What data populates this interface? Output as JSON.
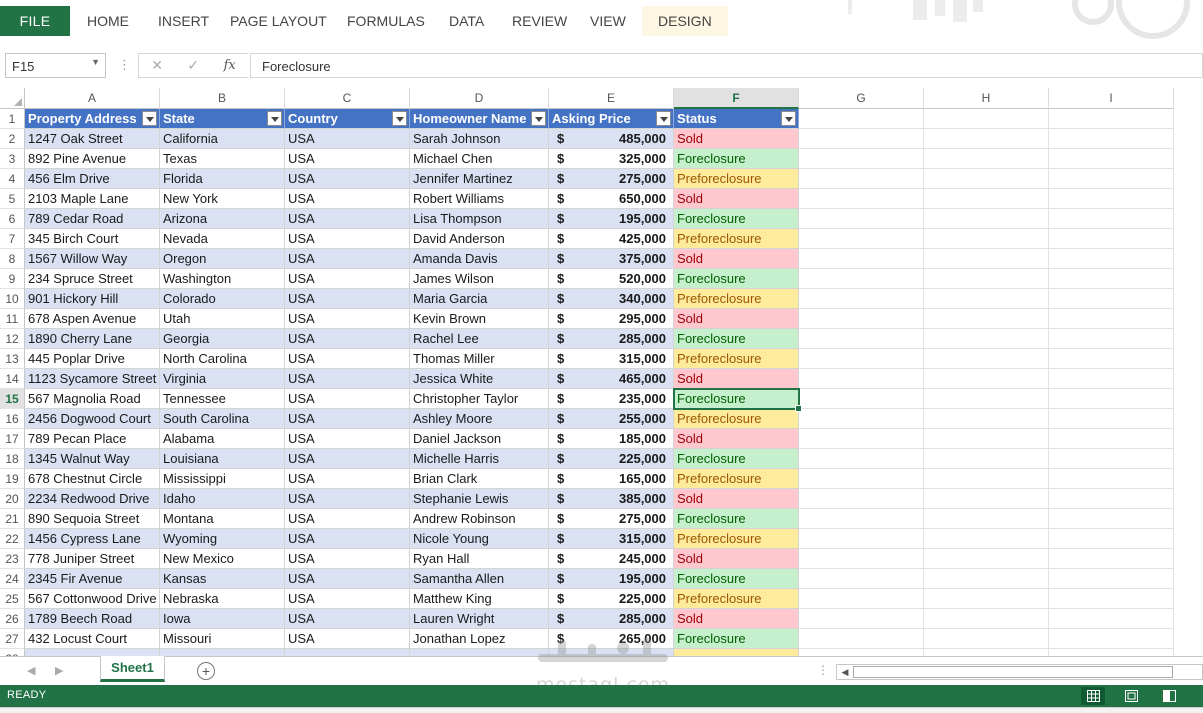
{
  "ribbon": {
    "file_label": "FILE",
    "tabs": [
      "HOME",
      "INSERT",
      "PAGE LAYOUT",
      "FORMULAS",
      "DATA",
      "REVIEW",
      "VIEW",
      "DESIGN"
    ]
  },
  "formula_bar": {
    "name_box": "F15",
    "fx_label": "fx",
    "cancel_icon": "close-icon",
    "enter_icon": "check-icon",
    "value": "Foreclosure"
  },
  "grid": {
    "columns": [
      "A",
      "B",
      "C",
      "D",
      "E",
      "F",
      "G",
      "H",
      "I"
    ],
    "selected_column": "F",
    "selected_row": 15,
    "active_cell": "F15",
    "header_row": [
      "Property Address",
      "State",
      "Country",
      "Homeowner Name",
      "Asking Price",
      "Status"
    ],
    "currency_symbol": "$",
    "rows": [
      [
        "1247 Oak Street",
        "California",
        "USA",
        "Sarah Johnson",
        "485,000",
        "Sold"
      ],
      [
        "892 Pine Avenue",
        "Texas",
        "USA",
        "Michael Chen",
        "325,000",
        "Foreclosure"
      ],
      [
        "456 Elm Drive",
        "Florida",
        "USA",
        "Jennifer Martinez",
        "275,000",
        "Preforeclosure"
      ],
      [
        "2103 Maple Lane",
        "New York",
        "USA",
        "Robert Williams",
        "650,000",
        "Sold"
      ],
      [
        "789 Cedar Road",
        "Arizona",
        "USA",
        "Lisa Thompson",
        "195,000",
        "Foreclosure"
      ],
      [
        "345 Birch Court",
        "Nevada",
        "USA",
        "David Anderson",
        "425,000",
        "Preforeclosure"
      ],
      [
        "1567 Willow Way",
        "Oregon",
        "USA",
        "Amanda Davis",
        "375,000",
        "Sold"
      ],
      [
        "234 Spruce Street",
        "Washington",
        "USA",
        "James Wilson",
        "520,000",
        "Foreclosure"
      ],
      [
        "901 Hickory Hill",
        "Colorado",
        "USA",
        "Maria Garcia",
        "340,000",
        "Preforeclosure"
      ],
      [
        "678 Aspen Avenue",
        "Utah",
        "USA",
        "Kevin Brown",
        "295,000",
        "Sold"
      ],
      [
        "1890 Cherry Lane",
        "Georgia",
        "USA",
        "Rachel Lee",
        "285,000",
        "Foreclosure"
      ],
      [
        "445 Poplar Drive",
        "North Carolina",
        "USA",
        "Thomas Miller",
        "315,000",
        "Preforeclosure"
      ],
      [
        "1123 Sycamore Street",
        "Virginia",
        "USA",
        "Jessica White",
        "465,000",
        "Sold"
      ],
      [
        "567 Magnolia Road",
        "Tennessee",
        "USA",
        "Christopher Taylor",
        "235,000",
        "Foreclosure"
      ],
      [
        "2456 Dogwood Court",
        "South Carolina",
        "USA",
        "Ashley Moore",
        "255,000",
        "Preforeclosure"
      ],
      [
        "789 Pecan Place",
        "Alabama",
        "USA",
        "Daniel Jackson",
        "185,000",
        "Sold"
      ],
      [
        "1345 Walnut Way",
        "Louisiana",
        "USA",
        "Michelle Harris",
        "225,000",
        "Foreclosure"
      ],
      [
        "678 Chestnut Circle",
        "Mississippi",
        "USA",
        "Brian Clark",
        "165,000",
        "Preforeclosure"
      ],
      [
        "2234 Redwood Drive",
        "Idaho",
        "USA",
        "Stephanie Lewis",
        "385,000",
        "Sold"
      ],
      [
        "890 Sequoia Street",
        "Montana",
        "USA",
        "Andrew Robinson",
        "275,000",
        "Foreclosure"
      ],
      [
        "1456 Cypress Lane",
        "Wyoming",
        "USA",
        "Nicole Young",
        "315,000",
        "Preforeclosure"
      ],
      [
        "778 Juniper Street",
        "New Mexico",
        "USA",
        "Ryan Hall",
        "245,000",
        "Sold"
      ],
      [
        "2345 Fir Avenue",
        "Kansas",
        "USA",
        "Samantha Allen",
        "195,000",
        "Foreclosure"
      ],
      [
        "567 Cottonwood Drive",
        "Nebraska",
        "USA",
        "Matthew King",
        "225,000",
        "Preforeclosure"
      ],
      [
        "1789 Beech Road",
        "Iowa",
        "USA",
        "Lauren Wright",
        "285,000",
        "Sold"
      ],
      [
        "432 Locust Court",
        "Missouri",
        "USA",
        "Jonathan Lopez",
        "265,000",
        "Foreclosure"
      ]
    ],
    "status_colors": {
      "Sold": {
        "bg": "#ffc7ce",
        "fg": "#9c0006"
      },
      "Foreclosure": {
        "bg": "#c6efce",
        "fg": "#006100"
      },
      "Preforeclosure": {
        "bg": "#ffeb9c",
        "fg": "#9c5700"
      }
    },
    "header_color": "#4472c4",
    "band_color": "#d9e1f2"
  },
  "sheet_tabs": {
    "active": "Sheet1",
    "add_icon": "plus-circle-icon"
  },
  "status_bar": {
    "text": "READY",
    "views": [
      "normal-view-icon",
      "page-layout-view-icon",
      "page-break-view-icon"
    ]
  },
  "watermark": {
    "text": "mostaql.com"
  },
  "accent_color": "#217346"
}
